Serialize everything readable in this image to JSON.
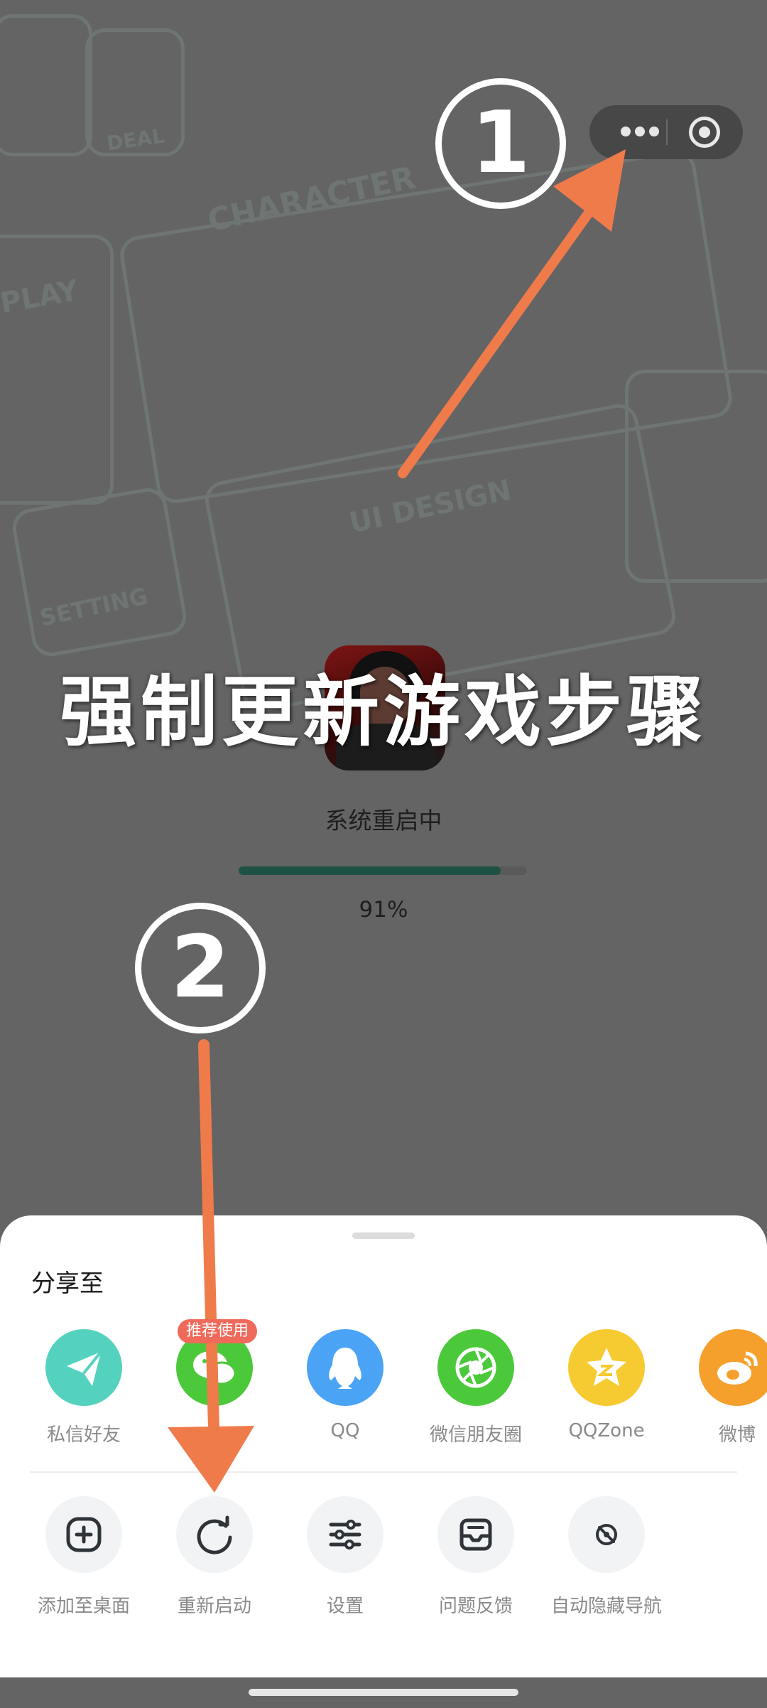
{
  "overlay": {
    "headline": "强制更新游戏步骤",
    "step1": "1",
    "step2": "2",
    "arrow_color": "#ef7b4b"
  },
  "capsule": {
    "more_icon": "more-dots-icon",
    "close_icon": "target-circle-icon"
  },
  "background_words": {
    "character": "CHARACTER",
    "ui_design": "UI DESIGN",
    "deal": "DEAL",
    "play": "PLAY",
    "setting": "SETTING"
  },
  "loading": {
    "status": "系统重启中",
    "progress_text": "91%",
    "progress_value": 0.91,
    "fill_color": "#1e5245"
  },
  "sheet": {
    "title": "分享至",
    "badge": "推荐使用",
    "share_items": [
      {
        "label": "私信好友",
        "icon": "paper-plane-icon",
        "color": "#55d2bf"
      },
      {
        "label": "",
        "icon": "wechat-icon",
        "color": "#4cc93a"
      },
      {
        "label": "QQ",
        "icon": "qq-penguin-icon",
        "color": "#4aa3f5"
      },
      {
        "label": "微信朋友圈",
        "icon": "moments-aperture-icon",
        "color": "#4cc93a"
      },
      {
        "label": "QQZone",
        "icon": "qzone-star-icon",
        "color": "#f6ca31"
      },
      {
        "label": "微博",
        "icon": "weibo-icon",
        "color": "#f5a02c"
      }
    ],
    "action_items": [
      {
        "label": "添加至桌面",
        "icon": "plus-square-icon"
      },
      {
        "label": "重新启动",
        "icon": "restart-icon"
      },
      {
        "label": "设置",
        "icon": "sliders-icon"
      },
      {
        "label": "问题反馈",
        "icon": "feedback-icon"
      },
      {
        "label": "自动隐藏导航",
        "icon": "eye-off-icon"
      }
    ]
  }
}
